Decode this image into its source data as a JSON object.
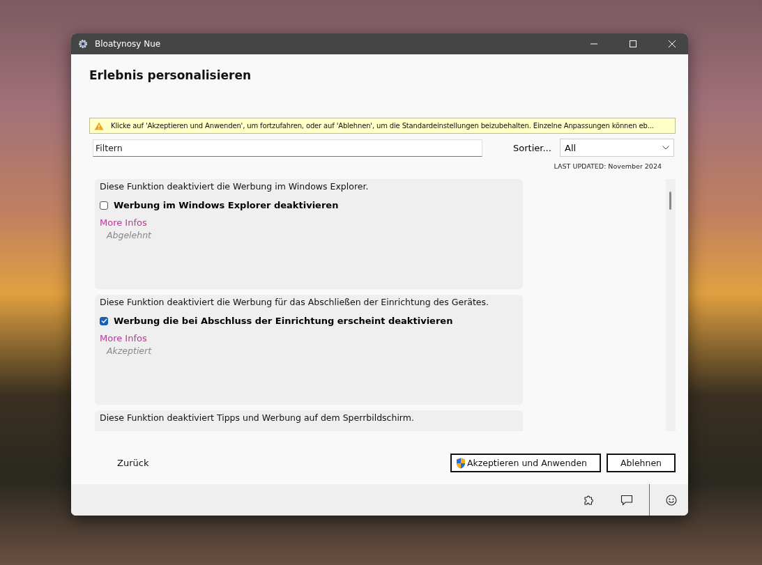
{
  "window": {
    "title": "Bloatynosy Nue"
  },
  "heading": "Erlebnis personalisieren",
  "warning": "Klicke auf 'Akzeptieren und Anwenden', um fortzufahren, oder auf 'Ablehnen', um die Standardeinstellungen beizubehalten. Einzelne Anpassungen können eb...",
  "filter": {
    "placeholder": "Filtern"
  },
  "sort": {
    "label": "Sortier...",
    "value": "All"
  },
  "last_updated": "LAST UPDATED: November 2024",
  "features": [
    {
      "description": "Diese Funktion deaktiviert die Werbung im Windows Explorer.",
      "label": "Werbung im Windows Explorer deaktivieren",
      "checked": false,
      "link": "More Infos",
      "status": "Abgelehnt"
    },
    {
      "description": "Diese Funktion deaktiviert die Werbung für das Abschließen der Einrichtung des Gerätes.",
      "label": "Werbung die bei Abschluss der Einrichtung erscheint deaktivieren",
      "checked": true,
      "link": "More Infos",
      "status": "Akzeptiert"
    },
    {
      "description": "Diese Funktion deaktiviert Tipps und Werbung auf dem Sperrbildschirm."
    }
  ],
  "back": "Zurück",
  "buttons": [
    {
      "label": "Akzeptieren und Anwenden",
      "kind": "shield"
    },
    {
      "label": "Ablehnen",
      "kind": "plain"
    }
  ]
}
